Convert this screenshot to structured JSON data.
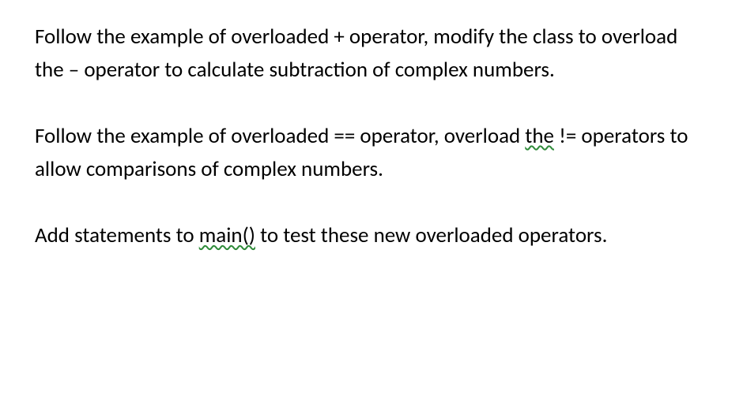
{
  "paragraphs": {
    "p1": {
      "t1": "Follow the example of overloaded + operator, modify the class to overload the – operator to calculate subtraction of complex numbers."
    },
    "p2": {
      "t1": "Follow the example of overloaded == operator, overload ",
      "wavy": "the",
      "t2": " != operators to allow comparisons of complex numbers."
    },
    "p3": {
      "t1": "Add statements to ",
      "wavy": "main()",
      "t2": " to test these new overloaded operators."
    }
  }
}
